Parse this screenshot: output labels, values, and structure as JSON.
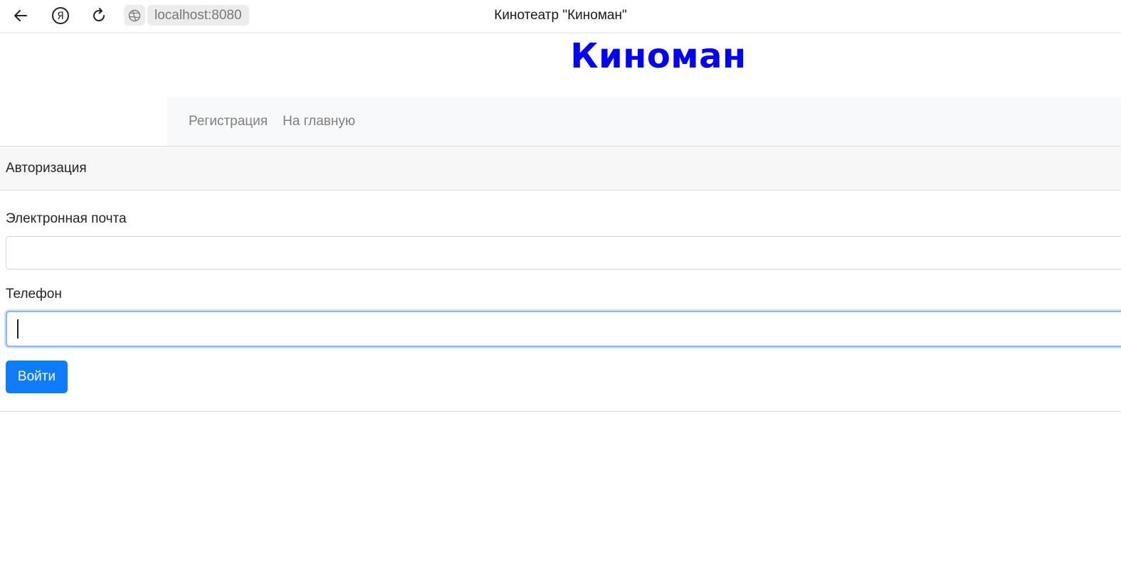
{
  "browser": {
    "url": "localhost:8080",
    "tab_title": "Кинотеатр \"Киноман\""
  },
  "site": {
    "logo": "Киноман",
    "logo_color": "#0000ff"
  },
  "nav": {
    "items": [
      {
        "label": "Регистрация"
      },
      {
        "label": "На главную"
      }
    ]
  },
  "login_form": {
    "header": "Авторизация",
    "email_label": "Электронная почта",
    "email_value": "",
    "phone_label": "Телефон",
    "phone_value": "",
    "submit_label": "Войти",
    "accent_color": "#0d7dfb"
  }
}
